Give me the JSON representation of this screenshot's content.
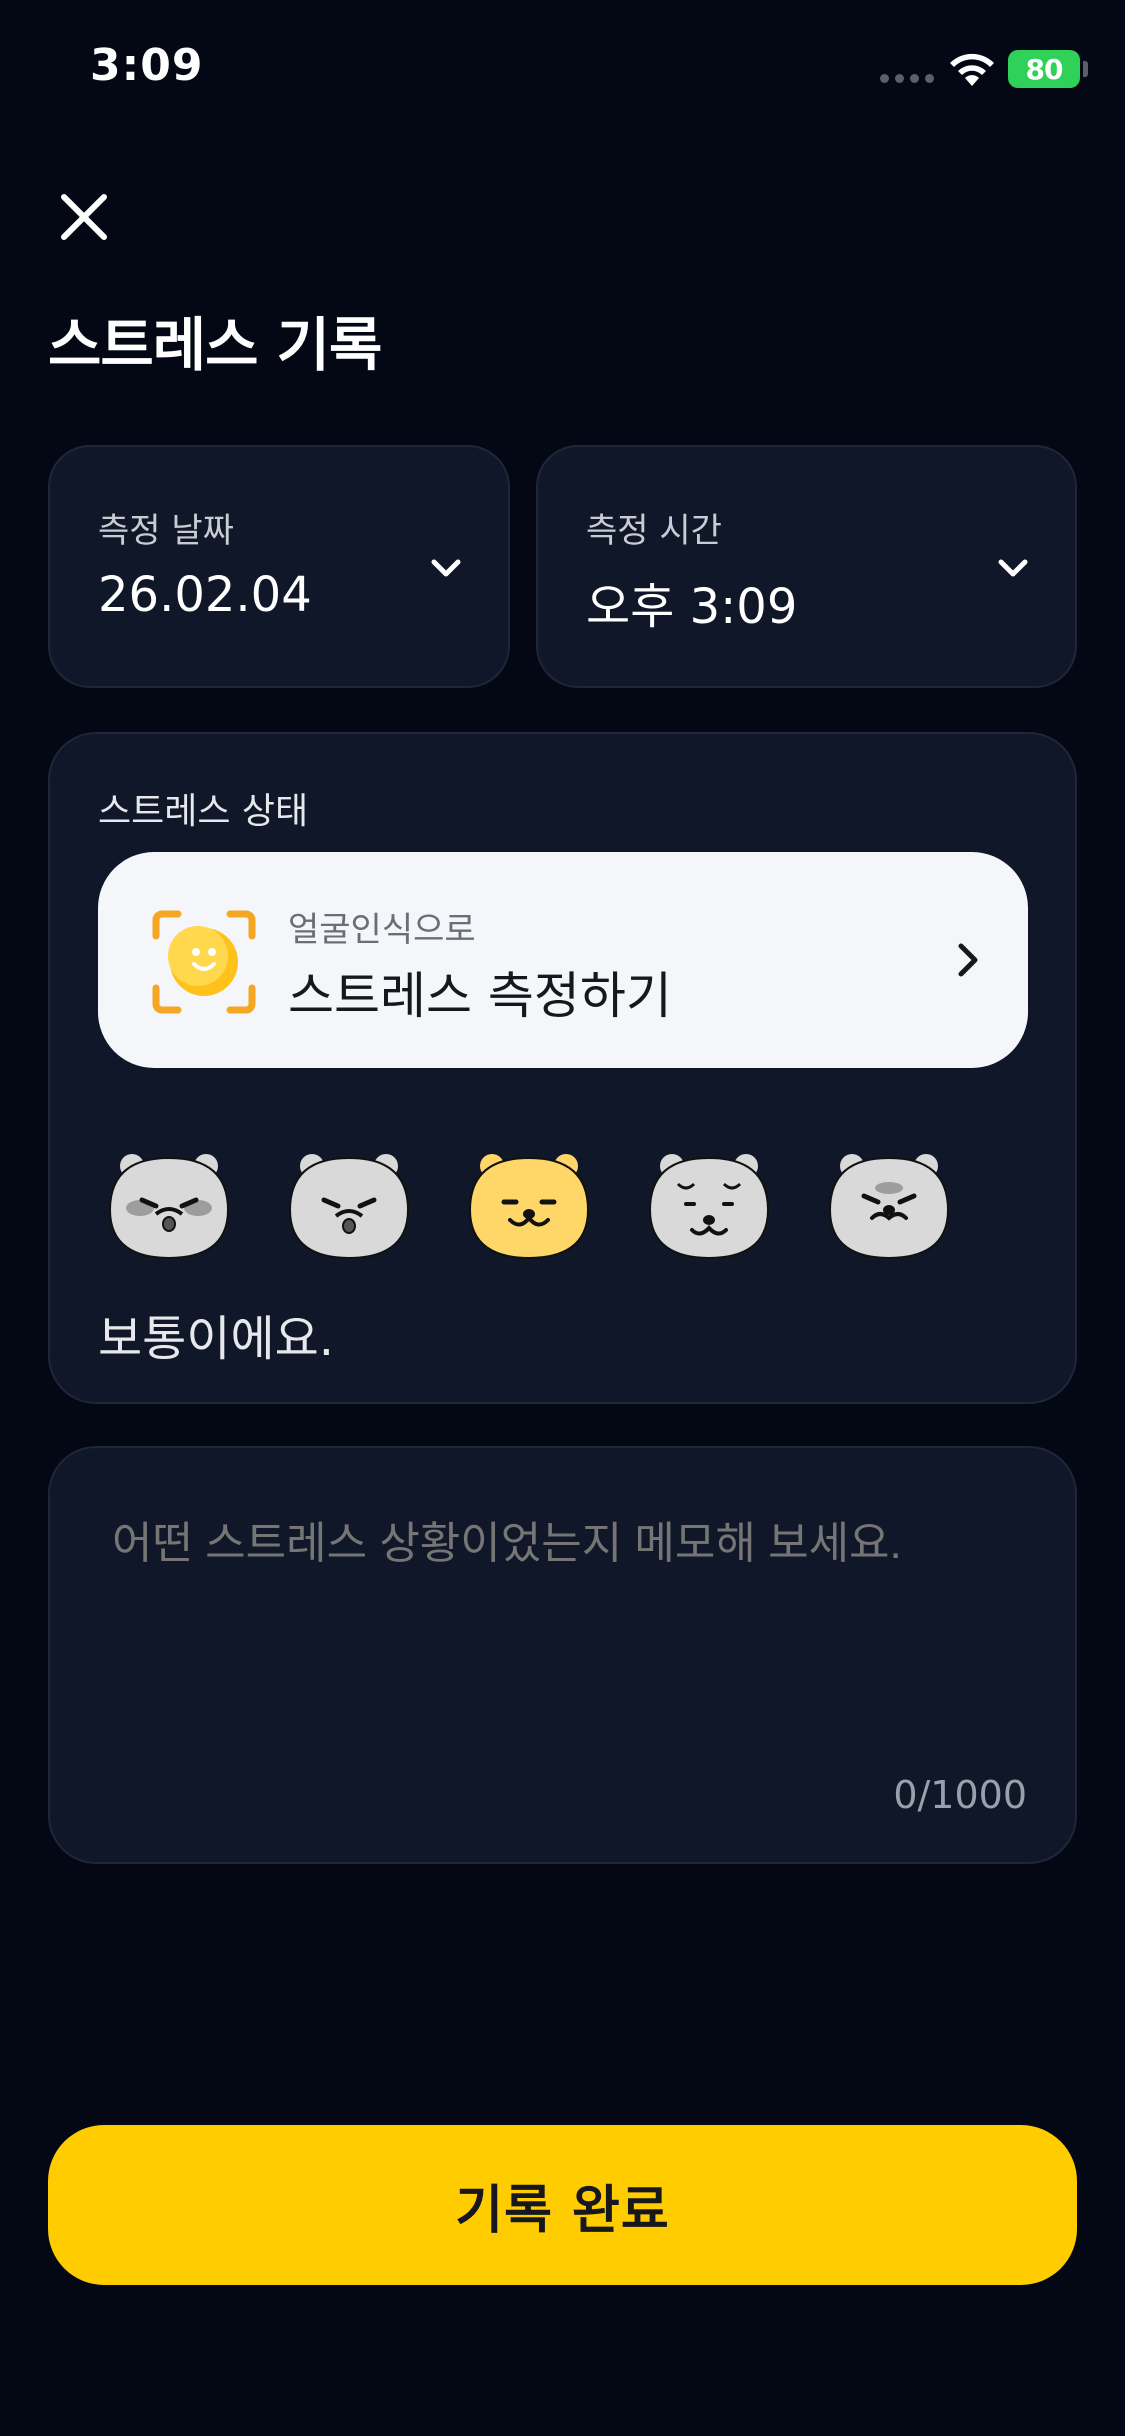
{
  "status_bar": {
    "time": "3:09",
    "battery": "80"
  },
  "header": {
    "title": "스트레스 기록",
    "close_icon": "close-icon"
  },
  "date_picker": {
    "label": "측정 날짜",
    "value": "26.02.04"
  },
  "time_picker": {
    "label": "측정 시간",
    "value": "오후 3:09"
  },
  "stress_status": {
    "label": "스트레스 상태",
    "face_measure": {
      "subtitle": "얼굴인식으로",
      "title": "스트레스 측정하기"
    },
    "moods": [
      {
        "id": "very-stressed",
        "selected": false
      },
      {
        "id": "stressed",
        "selected": false
      },
      {
        "id": "normal",
        "selected": true
      },
      {
        "id": "tired",
        "selected": false
      },
      {
        "id": "angry",
        "selected": false
      }
    ],
    "selected_caption": "보통이에요."
  },
  "memo": {
    "placeholder": "어떤 스트레스 상황이었는지 메모해 보세요.",
    "counter": "0/1000"
  },
  "footer": {
    "complete_label": "기록 완료"
  },
  "colors": {
    "background": "#030814",
    "card": "#101728",
    "accent": "#ffcc00",
    "battery": "#30d158",
    "mood_selected": "#ffd768",
    "mood_default": "#d9d9d9"
  }
}
